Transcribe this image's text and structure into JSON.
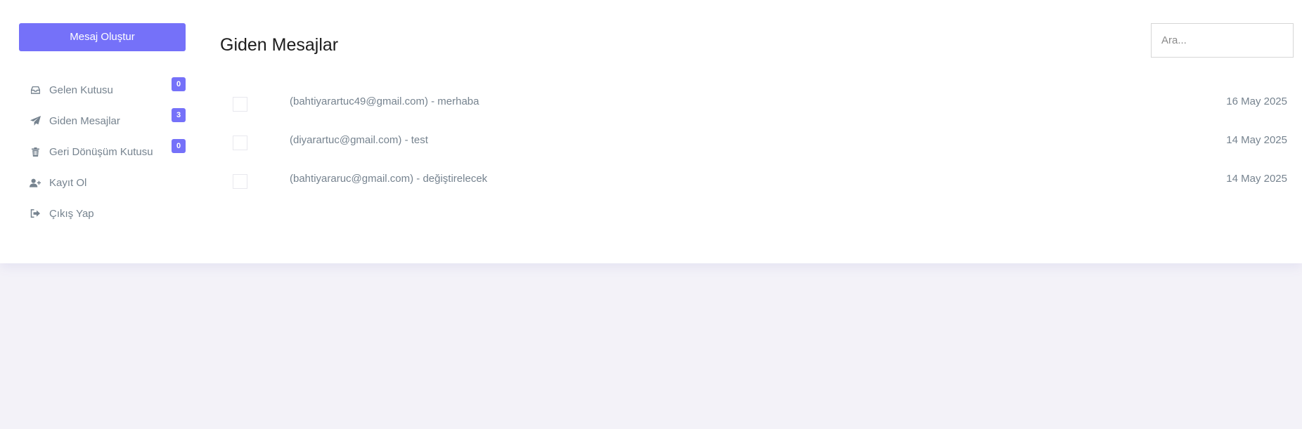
{
  "sidebar": {
    "compose_label": "Mesaj Oluştur",
    "items": [
      {
        "label": "Gelen Kutusu",
        "icon": "inbox-icon",
        "badge": "0"
      },
      {
        "label": "Giden Mesajlar",
        "icon": "paper-plane-icon",
        "badge": "3"
      },
      {
        "label": "Geri Dönüşüm Kutusu",
        "icon": "trash-icon",
        "badge": "0"
      },
      {
        "label": "Kayıt Ol",
        "icon": "user-plus-icon"
      },
      {
        "label": "Çıkış Yap",
        "icon": "sign-out-icon"
      }
    ]
  },
  "main": {
    "title": "Giden Mesajlar",
    "search_placeholder": "Ara...",
    "messages": [
      {
        "subject": "(bahtiyarartuc49@gmail.com) - merhaba",
        "date": "16 May 2025"
      },
      {
        "subject": "(diyarartuc@gmail.com) - test",
        "date": "14 May 2025"
      },
      {
        "subject": "(bahtiyararuc@gmail.com) - değiştirelecek",
        "date": "14 May 2025"
      }
    ]
  },
  "colors": {
    "accent": "#7571f9",
    "text_muted": "#76838f",
    "page_bg": "#f3f2f8",
    "card_bg": "#ffffff"
  }
}
